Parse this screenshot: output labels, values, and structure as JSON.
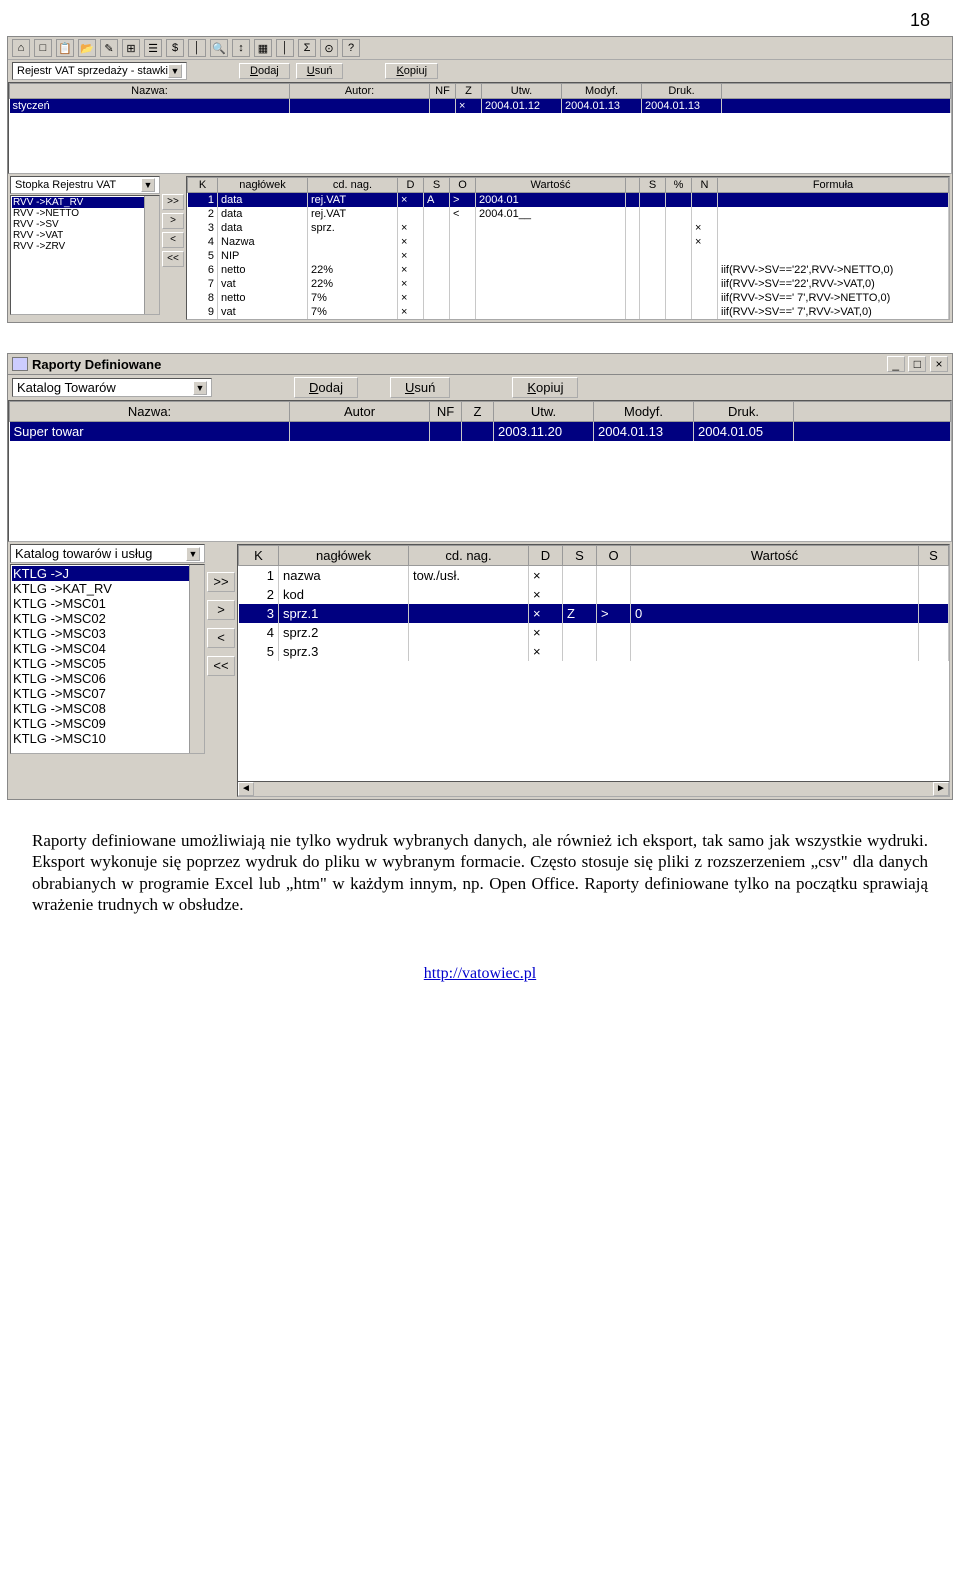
{
  "page_number": "18",
  "shot1": {
    "toolbar_icons": [
      "⌂",
      "□",
      "📋",
      "📂",
      "✎",
      "⊞",
      "☰",
      "$",
      "│",
      "🔍",
      "↕",
      "▦",
      "│",
      "Σ",
      "⊙",
      "?"
    ],
    "dropdown": "Rejestr VAT sprzedaży - stawki",
    "buttons": {
      "add": "Dodaj",
      "del": "Usuń",
      "copy": "Kopiuj"
    },
    "top_headers": [
      "Nazwa:",
      "Autor:",
      "NF",
      "Z",
      "Utw.",
      "Modyf.",
      "Druk."
    ],
    "top_row": {
      "name": "styczeń",
      "autor": "",
      "nf": "",
      "z": "×",
      "utw": "2004.01.12",
      "modyf": "2004.01.13",
      "druk": "2004.01.13"
    },
    "side_dropdown": "Stopka Rejestru VAT",
    "side_list": [
      "RVV    ->KAT_RV",
      "RVV    ->NETTO",
      "RVV    ->SV",
      "RVV    ->VAT",
      "RVV    ->ZRV"
    ],
    "side_sel": 0,
    "detail_headers": [
      "K",
      "nagłówek",
      "cd. nag.",
      "D",
      "S",
      "O",
      "Wartość",
      "",
      "S",
      "%",
      "N",
      "Formuła"
    ],
    "detail_rows": [
      {
        "k": "1",
        "nag": "data",
        "cd": "rej.VAT",
        "d": "×",
        "s": "A",
        "o": ">",
        "wart": "2004.01",
        "ss": "",
        "pc": "",
        "n": "",
        "f": ""
      },
      {
        "k": "2",
        "nag": "data",
        "cd": "rej.VAT",
        "d": "",
        "s": "",
        "o": "<",
        "wart": "2004.01__",
        "ss": "",
        "pc": "",
        "n": "",
        "f": ""
      },
      {
        "k": "3",
        "nag": "data",
        "cd": "sprz.",
        "d": "×",
        "s": "",
        "o": "",
        "wart": "",
        "ss": "",
        "pc": "",
        "n": "×",
        "f": ""
      },
      {
        "k": "4",
        "nag": "Nazwa",
        "cd": "",
        "d": "×",
        "s": "",
        "o": "",
        "wart": "",
        "ss": "",
        "pc": "",
        "n": "×",
        "f": ""
      },
      {
        "k": "5",
        "nag": "NIP",
        "cd": "",
        "d": "×",
        "s": "",
        "o": "",
        "wart": "",
        "ss": "",
        "pc": "",
        "n": "",
        "f": ""
      },
      {
        "k": "6",
        "nag": "netto",
        "cd": "22%",
        "d": "×",
        "s": "",
        "o": "",
        "wart": "",
        "ss": "",
        "pc": "",
        "n": "",
        "f": "iif(RVV->SV=='22',RVV->NETTO,0)"
      },
      {
        "k": "7",
        "nag": "vat",
        "cd": "22%",
        "d": "×",
        "s": "",
        "o": "",
        "wart": "",
        "ss": "",
        "pc": "",
        "n": "",
        "f": "iif(RVV->SV=='22',RVV->VAT,0)"
      },
      {
        "k": "8",
        "nag": "netto",
        "cd": "7%",
        "d": "×",
        "s": "",
        "o": "",
        "wart": "",
        "ss": "",
        "pc": "",
        "n": "",
        "f": "iif(RVV->SV==' 7',RVV->NETTO,0)"
      },
      {
        "k": "9",
        "nag": "vat",
        "cd": "7%",
        "d": "×",
        "s": "",
        "o": "",
        "wart": "",
        "ss": "",
        "pc": "",
        "n": "",
        "f": "iif(RVV->SV==' 7',RVV->VAT,0)"
      }
    ],
    "detail_sel": 0
  },
  "shot2": {
    "title": "Raporty Definiowane",
    "dropdown": "Katalog Towarów",
    "buttons": {
      "add": "Dodaj",
      "del": "Usuń",
      "copy": "Kopiuj"
    },
    "top_headers": [
      "Nazwa:",
      "Autor",
      "NF",
      "Z",
      "Utw.",
      "Modyf.",
      "Druk."
    ],
    "top_row": {
      "name": "Super towar",
      "autor": "",
      "nf": "",
      "z": "",
      "utw": "2003.11.20",
      "modyf": "2004.01.13",
      "druk": "2004.01.05"
    },
    "side_dropdown": "Katalog towarów i usług",
    "side_list": [
      "KTLG   ->J",
      "KTLG   ->KAT_RV",
      "KTLG   ->MSC01",
      "KTLG   ->MSC02",
      "KTLG   ->MSC03",
      "KTLG   ->MSC04",
      "KTLG   ->MSC05",
      "KTLG   ->MSC06",
      "KTLG   ->MSC07",
      "KTLG   ->MSC08",
      "KTLG   ->MSC09",
      "KTLG   ->MSC10"
    ],
    "side_sel": 0,
    "detail_headers": [
      "K",
      "nagłówek",
      "cd. nag.",
      "D",
      "S",
      "O",
      "Wartość",
      "S"
    ],
    "detail_rows": [
      {
        "k": "1",
        "nag": "nazwa",
        "cd": "tow./usł.",
        "d": "×",
        "s": "",
        "o": "",
        "wart": "",
        "ss": ""
      },
      {
        "k": "2",
        "nag": "kod",
        "cd": "",
        "d": "×",
        "s": "",
        "o": "",
        "wart": "",
        "ss": ""
      },
      {
        "k": "3",
        "nag": "sprz.1",
        "cd": "",
        "d": "×",
        "s": "Z",
        "o": ">",
        "wart": "0",
        "ss": ""
      },
      {
        "k": "4",
        "nag": "sprz.2",
        "cd": "",
        "d": "×",
        "s": "",
        "o": "",
        "wart": "",
        "ss": ""
      },
      {
        "k": "5",
        "nag": "sprz.3",
        "cd": "",
        "d": "×",
        "s": "",
        "o": "",
        "wart": "",
        "ss": ""
      }
    ],
    "detail_sel": 2
  },
  "body_text": "Raporty definiowane umożliwiają nie tylko wydruk wybranych danych, ale również ich eksport, tak samo jak wszystkie wydruki. Eksport wykonuje się poprzez wydruk do pliku w wybranym formacie. Często stosuje się pliki z rozszerzeniem „csv\" dla danych obrabianych w programie Excel lub „htm\" w każdym innym, np. Open Office. Raporty definiowane tylko na początku sprawiają wrażenie trudnych w obsłudze.",
  "footer_url": "http://vatowiec.pl"
}
